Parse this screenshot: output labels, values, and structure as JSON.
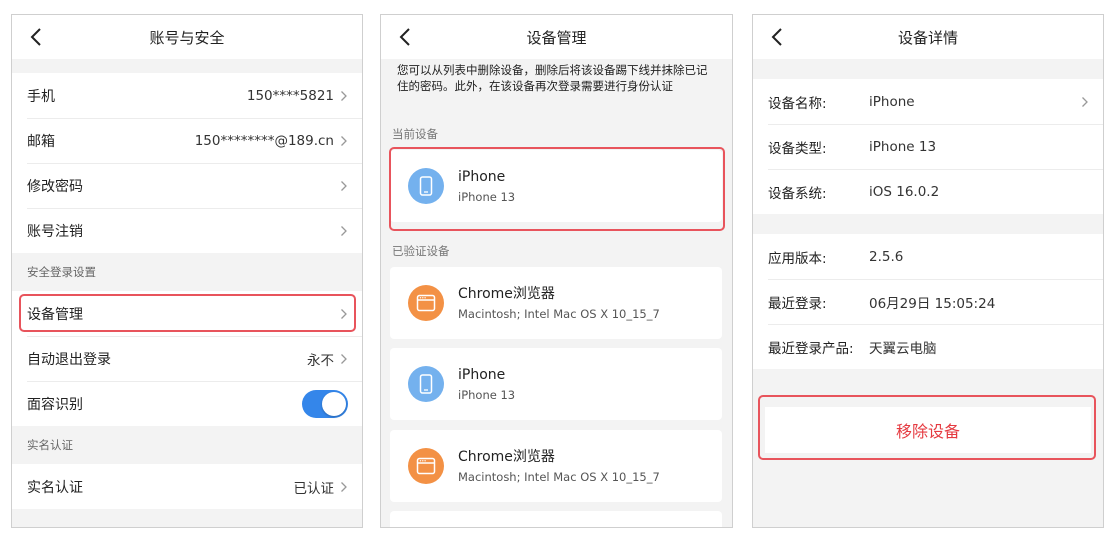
{
  "screen1": {
    "title": "账号与安全",
    "account_rows": [
      {
        "label": "手机",
        "value": "150****5821"
      },
      {
        "label": "邮箱",
        "value": "150********@189.cn"
      },
      {
        "label": "修改密码",
        "value": ""
      },
      {
        "label": "账号注销",
        "value": ""
      }
    ],
    "security_header": "安全登录设置",
    "security_rows": [
      {
        "label": "设备管理",
        "value": ""
      },
      {
        "label": "自动退出登录",
        "value": "永不"
      },
      {
        "label": "面容识别",
        "toggle": "on"
      }
    ],
    "realname_header": "实名认证",
    "realname_rows": [
      {
        "label": "实名认证",
        "value": "已认证"
      }
    ]
  },
  "screen2": {
    "title": "设备管理",
    "notice": "您可以从列表中删除设备，删除后将该设备踢下线并抹除已记住的密码。此外，在该设备再次登录需要进行身份认证",
    "current_header": "当前设备",
    "current_device": {
      "name": "iPhone",
      "sub": "iPhone 13",
      "icon": "phone-icon"
    },
    "verified_header": "已验证设备",
    "verified_devices": [
      {
        "name": "Chrome浏览器",
        "sub": "Macintosh; Intel Mac OS X 10_15_7",
        "icon": "browser-icon"
      },
      {
        "name": "iPhone",
        "sub": "iPhone 13",
        "icon": "phone-icon"
      },
      {
        "name": "Chrome浏览器",
        "sub": "Macintosh; Intel Mac OS X 10_15_7",
        "icon": "browser-icon"
      }
    ]
  },
  "screen3": {
    "title": "设备详情",
    "group1": [
      {
        "label": "设备名称:",
        "value": "iPhone",
        "chevron": true
      },
      {
        "label": "设备类型:",
        "value": "iPhone 13"
      },
      {
        "label": "设备系统:",
        "value": "iOS 16.0.2"
      }
    ],
    "group2": [
      {
        "label": "应用版本:",
        "value": "2.5.6"
      },
      {
        "label": "最近登录:",
        "value": "06月29日 15:05:24"
      },
      {
        "label": "最近登录产品:",
        "value": "天翼云电脑"
      }
    ],
    "remove_label": "移除设备"
  },
  "colors": {
    "accent": "#3486ea",
    "highlight": "#e8545c",
    "danger": "#e53a40",
    "phone_icon_bg": "#74b1ee",
    "browser_icon_bg": "#f39145"
  }
}
